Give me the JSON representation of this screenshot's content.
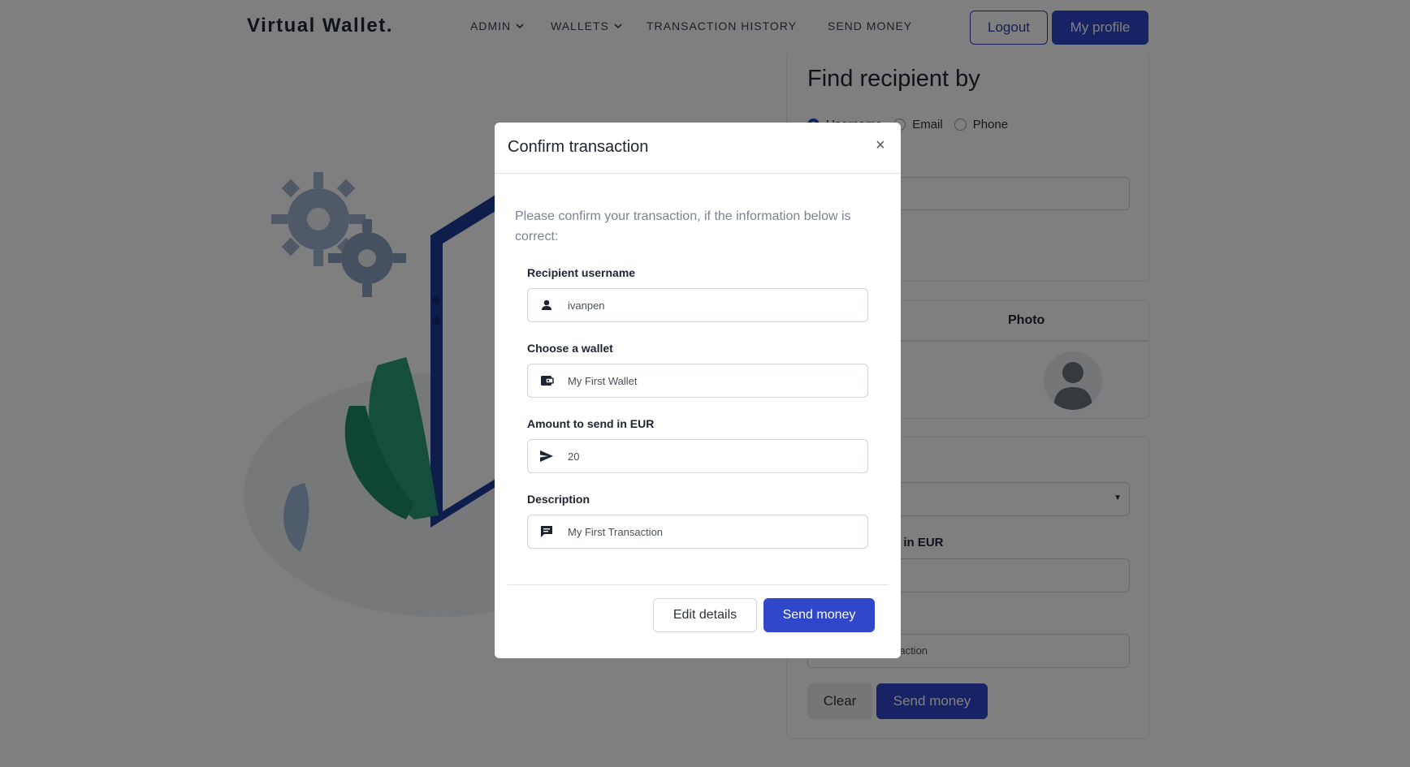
{
  "navbar": {
    "brand": "Virtual Wallet.",
    "links": {
      "admin": "ADMIN",
      "wallets": "WALLETS",
      "history": "TRANSACTION HISTORY",
      "send": "SEND MONEY"
    },
    "logout": "Logout",
    "profile": "My profile"
  },
  "background": {
    "find_title": "Find recipient by",
    "radio": {
      "username": "Username",
      "email": "Email",
      "phone": "Phone"
    },
    "photo_header": "Photo",
    "amount_label": "Amount to send in EUR",
    "description_value": "My First Transaction",
    "clear_button": "Clear",
    "send_button": "Send money"
  },
  "modal": {
    "title": "Confirm transaction",
    "close": "×",
    "intro": "Please confirm your transaction, if the information below is correct:",
    "fields": {
      "recipient": {
        "label": "Recipient username",
        "value": "ivanpen",
        "icon": "person-icon"
      },
      "wallet": {
        "label": "Choose a wallet",
        "value": "My First Wallet",
        "icon": "wallet-icon"
      },
      "amount": {
        "label": "Amount to send in EUR",
        "value": "20",
        "icon": "send-icon"
      },
      "description": {
        "label": "Description",
        "value": "My First Transaction",
        "icon": "message-icon"
      }
    },
    "edit_button": "Edit details",
    "send_button": "Send money"
  },
  "colors": {
    "primary": "#2f47c8",
    "overlay": "rgba(0,0,0,0.5)"
  }
}
